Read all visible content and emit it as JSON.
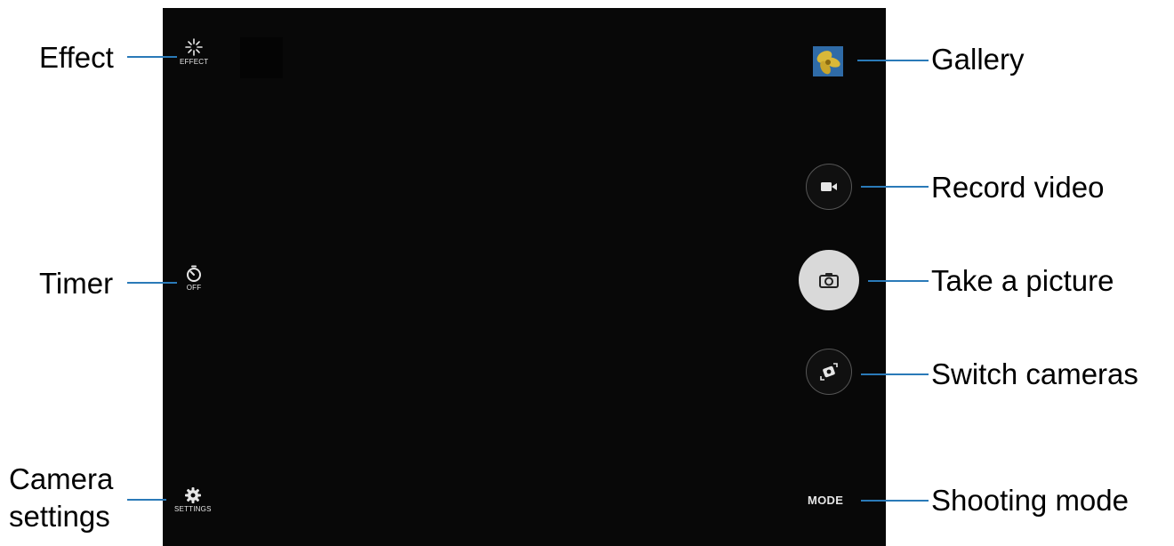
{
  "screen": {
    "effect_label": "EFFECT",
    "timer_label": "OFF",
    "settings_label": "SETTINGS",
    "mode_label": "MODE"
  },
  "callouts": {
    "effect": "Effect",
    "timer": "Timer",
    "camera_settings_line1": "Camera",
    "camera_settings_line2": "settings",
    "gallery": "Gallery",
    "record_video": "Record video",
    "take_picture": "Take a picture",
    "switch_cameras": "Switch cameras",
    "shooting_mode": "Shooting mode"
  },
  "icons": {
    "effect": "sparkle-icon",
    "timer": "timer-icon",
    "settings": "gear-icon",
    "gallery": "gallery-thumbnail",
    "record": "video-camera-icon",
    "shutter": "camera-icon",
    "switch": "switch-camera-icon"
  },
  "colors": {
    "leader_line": "#2a7ab8",
    "viewfinder": "#080808",
    "shutter": "#d9d9d9"
  }
}
